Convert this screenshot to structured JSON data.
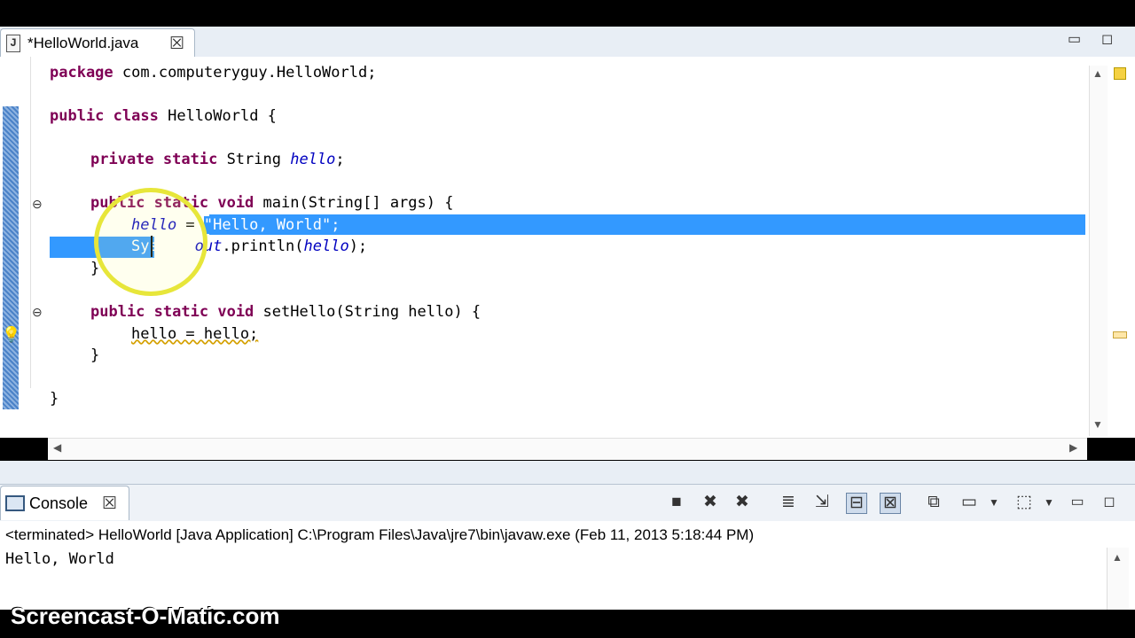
{
  "editor_tab": {
    "file_icon": "J",
    "title": "*HelloWorld.java",
    "close": "☒"
  },
  "window_controls": {
    "minimize": "▭",
    "maximize": "◻"
  },
  "code": {
    "l1_kw": "package",
    "l1_rest": " com.computeryguy.HelloWorld;",
    "l2_kw1": "public",
    "l2_kw2": "class",
    "l2_rest": " HelloWorld {",
    "l3_kw1": "private",
    "l3_kw2": "static",
    "l3_type": " String ",
    "l3_field": "hello",
    "l3_end": ";",
    "l4_kw1": "public",
    "l4_kw2": "static",
    "l4_kw3": "void",
    "l4_rest": " main(String[] args) {",
    "l5_field": "hello",
    "l5_eq": " = ",
    "l5_str": "\"Hello, World\"",
    "l5_end": ";",
    "l6_a": "System.",
    "l6_field": "out",
    "l6_b": ".println(",
    "l6_arg": "hello",
    "l6_c": ");",
    "l7": "}",
    "l8_kw1": "public",
    "l8_kw2": "static",
    "l8_kw3": "void",
    "l8_rest": " setHello(String hello) {",
    "l9": "hello = hello;",
    "l10": "}",
    "l11": "}"
  },
  "console": {
    "tab_title": "Console",
    "close": "☒",
    "status": "<terminated> HelloWorld [Java Application] C:\\Program Files\\Java\\jre7\\bin\\javaw.exe (Feb 11, 2013 5:18:44 PM)",
    "output": "Hello, World"
  },
  "toolbar_icons": [
    "terminate-icon",
    "remove-launch-icon",
    "remove-all-icon",
    "scroll-lock-icon",
    "word-wrap-icon",
    "pin-console-icon",
    "display-console-icon",
    "open-console-icon",
    "view-menu-icon"
  ],
  "watermark": "Screencast-O-Matic.com"
}
